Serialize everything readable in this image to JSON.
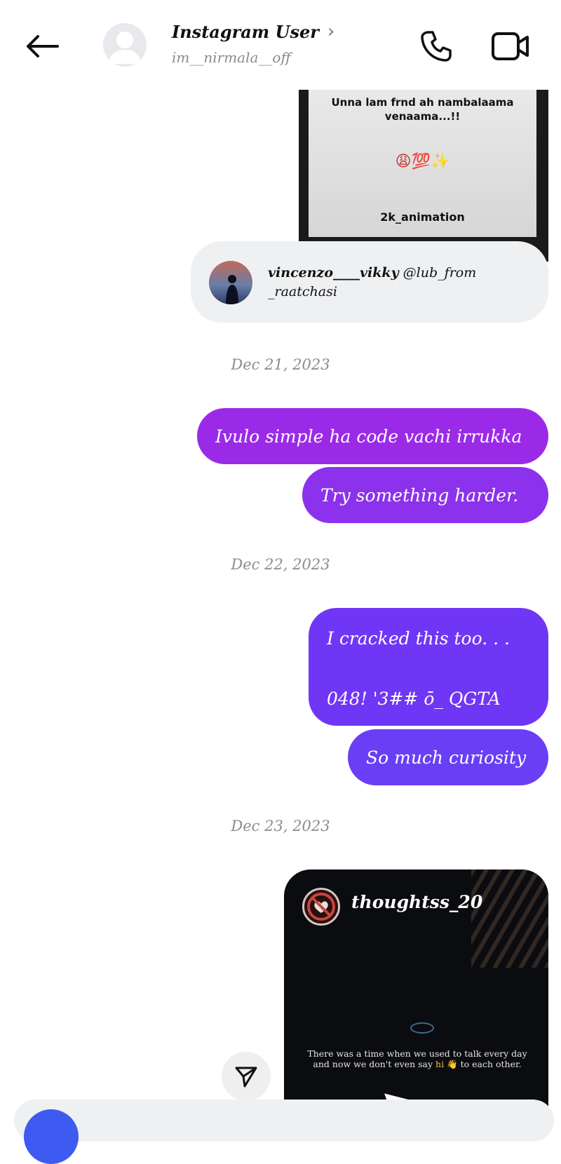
{
  "header": {
    "title": "Instagram User",
    "subtitle": "im__nirmala__off",
    "chevron": "›"
  },
  "shared_post": {
    "caption_line1": "Unna lam frnd ah nambalaama",
    "caption_line2": "venaama...!!",
    "emoji": "😩💯✨",
    "watermark": "2k_animation",
    "author": "vincenzo____vikky",
    "author_rest": " @lub_from",
    "author_line2": "_raatchasi"
  },
  "messages": {
    "date1": "Dec 21, 2023",
    "m1": "Ivulo simple ha code vachi irrukka",
    "m2": "Try something harder.",
    "date2": "Dec 22, 2023",
    "m3_line1": "I cracked this too. . .",
    "m3_line2": "048! '3## ō_ QGTA",
    "m4": "So much curiosity",
    "date3": "Dec 23, 2023"
  },
  "shared_reel": {
    "username": "thoughtss_20",
    "caption_line1": "There was a time when we used to talk every day",
    "caption_pre": "and now we don't even say ",
    "caption_hi": "hi",
    "caption_emoji": " 👋 ",
    "caption_post": "to each other."
  },
  "colors": {
    "bubble1": "#9b2ae8",
    "bubble2": "#8c31ec",
    "bubble3": "#7036f5",
    "bubble4": "#6a3ef4",
    "camera": "#3d5af1"
  },
  "icons": {
    "back": "arrow-left-icon",
    "call": "phone-icon",
    "video": "video-camera-icon",
    "share": "send-icon"
  }
}
